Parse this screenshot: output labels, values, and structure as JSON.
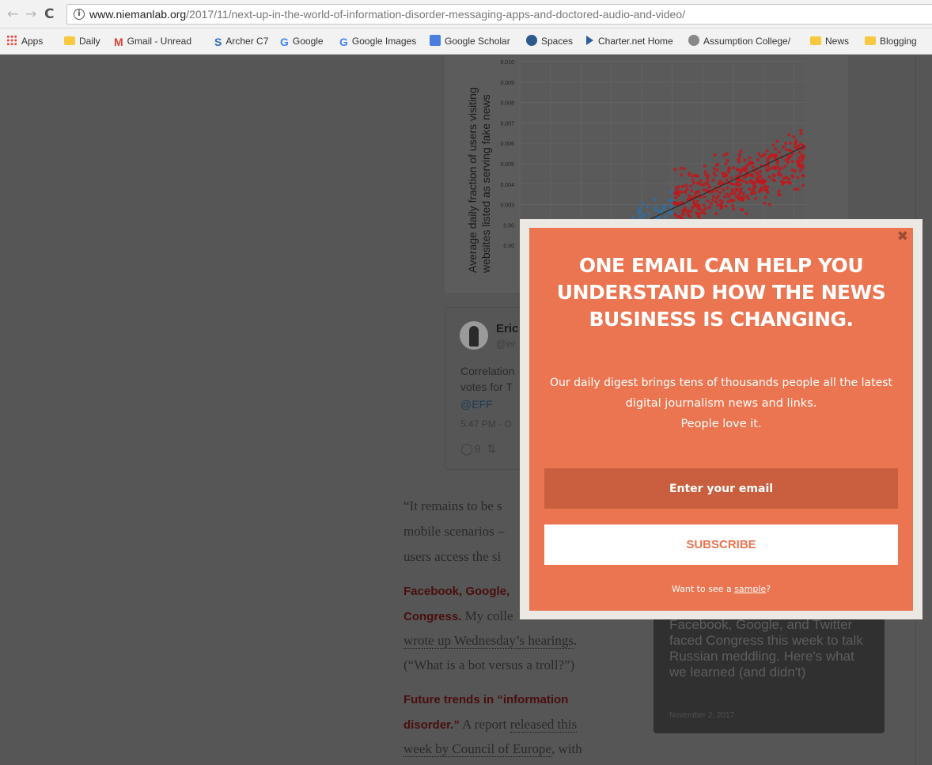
{
  "browser": {
    "nav_back": "←",
    "nav_forward": "→",
    "reload": "C",
    "info": "i",
    "url_domain": "www.niemanlab.org",
    "url_path": "/2017/11/next-up-in-the-world-of-information-disorder-messaging-apps-and-doctored-audio-and-video/"
  },
  "bookmarks": [
    {
      "label": "Apps",
      "icon": "apps-grid-icon"
    },
    {
      "label": "Daily",
      "icon": "folder-icon"
    },
    {
      "label": "Gmail - Unread",
      "icon": "gmail-icon"
    },
    {
      "label": "Archer C7",
      "icon": "archer-icon"
    },
    {
      "label": "Google",
      "icon": "google-icon"
    },
    {
      "label": "Google Images",
      "icon": "google-icon"
    },
    {
      "label": "Google Scholar",
      "icon": "google-scholar-icon"
    },
    {
      "label": "Spaces",
      "icon": "spaces-icon"
    },
    {
      "label": "Charter.net Home",
      "icon": "charter-icon"
    },
    {
      "label": "Assumption College/",
      "icon": "globe-icon"
    },
    {
      "label": "News",
      "icon": "folder-icon"
    },
    {
      "label": "Blogging",
      "icon": "folder-icon"
    }
  ],
  "chart_data": {
    "type": "scatter",
    "ylabel": "Average daily fraction of users visiting websites listed as serving fake news",
    "yticks": [
      "0.010",
      "0.009",
      "0.008",
      "0.007",
      "0.006",
      "0.005",
      "0.004",
      "0.003",
      "0.00",
      "0.00"
    ],
    "colors": {
      "series_a": "#2b6ea6",
      "series_b": "#c0191c"
    }
  },
  "tweet": {
    "name": "Eric",
    "handle": "@er",
    "text_line1": "Correlation",
    "text_line2": "votes for T",
    "mention": "@EFF",
    "time": "5:47 PM - O",
    "actions": "◯9  ⇅"
  },
  "article": {
    "p1_line1": "“It remains to be s",
    "p1_line2": "mobile scenarios –",
    "p1_line3": "users access the si",
    "h1_line1": "Facebook, Google,",
    "h1_line2_bold": "Congress.",
    "h1_line2_rest": " My colle",
    "link1": "wrote up Wednesday’s hearings",
    "after_link1": ".",
    "quote": "(“What is a bot versus a troll?”)",
    "h2_line1": "Future trends in “information",
    "h2_line2_bold": "disorder.”",
    "h2_line2_rest": " A report ",
    "link2a": "released this",
    "link2b": "week by Council of Europe",
    "after_link2": ", with"
  },
  "related_card": {
    "text": "Facebook, Google, and Twitter faced Congress this week to talk Russian meddling. Here's what we learned (and didn't)",
    "date": "November 2, 2017"
  },
  "modal": {
    "close": "✖",
    "title_line1": "ONE EMAIL CAN HELP YOU",
    "title_line2": "UNDERSTAND HOW THE NEWS",
    "title_line3": "BUSINESS IS CHANGING.",
    "desc_line1": "Our daily digest brings tens of thousands people all the latest",
    "desc_line2": "digital journalism news and links.",
    "desc_line3": "People love it.",
    "email_placeholder": "Enter your email",
    "subscribe_label": "SUBSCRIBE",
    "sample_prefix": "Want to see a ",
    "sample_link": "sample",
    "sample_suffix": "?"
  }
}
